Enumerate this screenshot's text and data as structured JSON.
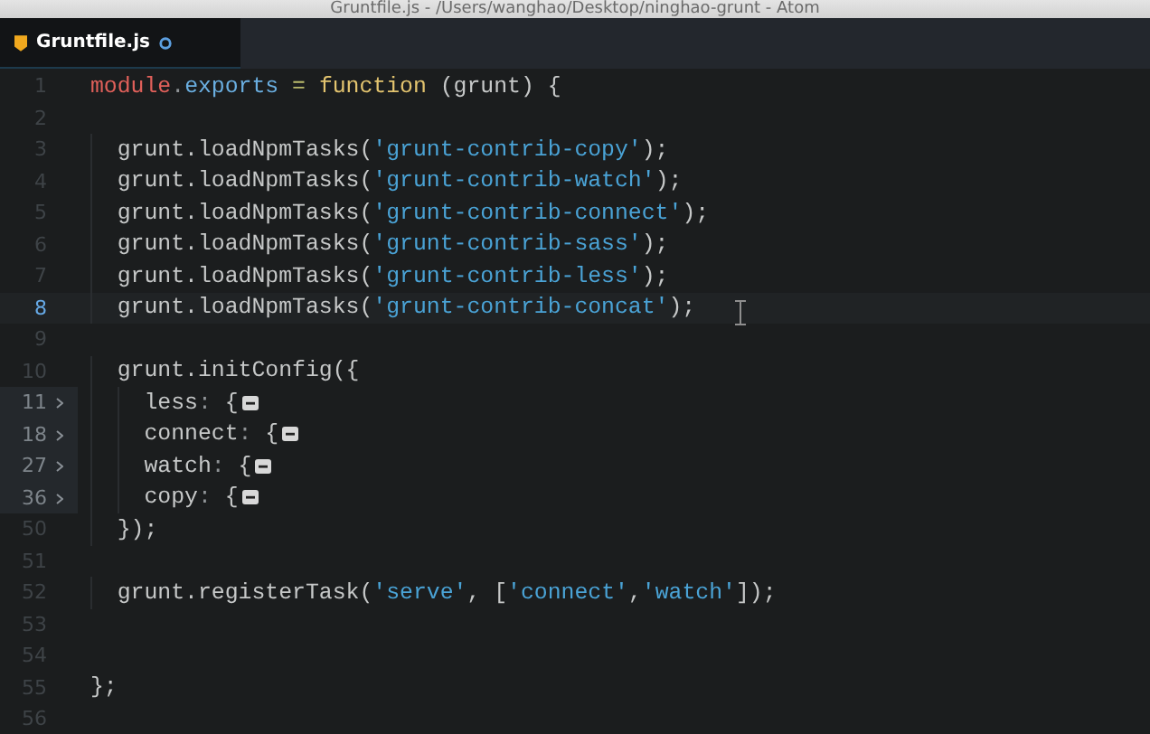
{
  "window": {
    "title": "Gruntfile.js - /Users/wanghao/Desktop/ninghao-grunt - Atom"
  },
  "tabs": [
    {
      "label": "Gruntfile.js",
      "selected": true,
      "modified": true
    }
  ],
  "lines": [
    {
      "number": "1",
      "current": false,
      "folded": false,
      "tokens": [
        {
          "kind": "variable",
          "text": "module"
        },
        {
          "kind": "punct",
          "text": "."
        },
        {
          "kind": "property",
          "text": "exports"
        },
        {
          "kind": "operator",
          "text": " = "
        },
        {
          "kind": "keyword",
          "text": "function"
        },
        {
          "kind": "plain",
          "text": " (grunt) {"
        }
      ]
    },
    {
      "number": "2",
      "current": false,
      "folded": false
    },
    {
      "number": "3",
      "current": false,
      "folded": false,
      "tokens": [
        {
          "kind": "plain",
          "text": "  grunt.loadNpmTasks("
        },
        {
          "kind": "string",
          "text": "'grunt-contrib-copy'"
        },
        {
          "kind": "plain",
          "text": ");"
        }
      ]
    },
    {
      "number": "4",
      "current": false,
      "folded": false,
      "tokens": [
        {
          "kind": "plain",
          "text": "  grunt.loadNpmTasks("
        },
        {
          "kind": "string",
          "text": "'grunt-contrib-watch'"
        },
        {
          "kind": "plain",
          "text": ");"
        }
      ]
    },
    {
      "number": "5",
      "current": false,
      "folded": false,
      "tokens": [
        {
          "kind": "plain",
          "text": "  grunt.loadNpmTasks("
        },
        {
          "kind": "string",
          "text": "'grunt-contrib-connect'"
        },
        {
          "kind": "plain",
          "text": ");"
        }
      ]
    },
    {
      "number": "6",
      "current": false,
      "folded": false,
      "tokens": [
        {
          "kind": "plain",
          "text": "  grunt.loadNpmTasks("
        },
        {
          "kind": "string",
          "text": "'grunt-contrib-sass'"
        },
        {
          "kind": "plain",
          "text": ");"
        }
      ]
    },
    {
      "number": "7",
      "current": false,
      "folded": false,
      "tokens": [
        {
          "kind": "plain",
          "text": "  grunt.loadNpmTasks("
        },
        {
          "kind": "string",
          "text": "'grunt-contrib-less'"
        },
        {
          "kind": "plain",
          "text": ");"
        }
      ]
    },
    {
      "number": "8",
      "current": true,
      "folded": false,
      "tokens": [
        {
          "kind": "plain",
          "text": "  grunt.loadNpmTasks("
        },
        {
          "kind": "string",
          "text": "'grunt-contrib-concat'"
        },
        {
          "kind": "plain",
          "text": ");"
        }
      ]
    },
    {
      "number": "9",
      "current": false,
      "folded": false
    },
    {
      "number": "10",
      "current": false,
      "folded": false,
      "tokens": [
        {
          "kind": "plain",
          "text": "  grunt.initConfig({"
        }
      ]
    },
    {
      "number": "11",
      "current": false,
      "folded": true,
      "tokens": [
        {
          "kind": "plain",
          "text": "    less"
        },
        {
          "kind": "punct",
          "text": ":"
        },
        {
          "kind": "plain",
          "text": " {"
        }
      ]
    },
    {
      "number": "18",
      "current": false,
      "folded": true,
      "tokens": [
        {
          "kind": "plain",
          "text": "    connect"
        },
        {
          "kind": "punct",
          "text": ":"
        },
        {
          "kind": "plain",
          "text": " {"
        }
      ]
    },
    {
      "number": "27",
      "current": false,
      "folded": true,
      "tokens": [
        {
          "kind": "plain",
          "text": "    watch"
        },
        {
          "kind": "punct",
          "text": ":"
        },
        {
          "kind": "plain",
          "text": " {"
        }
      ]
    },
    {
      "number": "36",
      "current": false,
      "folded": true,
      "tokens": [
        {
          "kind": "plain",
          "text": "    copy"
        },
        {
          "kind": "punct",
          "text": ":"
        },
        {
          "kind": "plain",
          "text": " {"
        }
      ]
    },
    {
      "number": "50",
      "current": false,
      "folded": false,
      "tokens": [
        {
          "kind": "plain",
          "text": "  });"
        }
      ]
    },
    {
      "number": "51",
      "current": false,
      "folded": false
    },
    {
      "number": "52",
      "current": false,
      "folded": false,
      "tokens": [
        {
          "kind": "plain",
          "text": "  grunt.registerTask("
        },
        {
          "kind": "string",
          "text": "'serve'"
        },
        {
          "kind": "plain",
          "text": ", ["
        },
        {
          "kind": "string",
          "text": "'connect'"
        },
        {
          "kind": "plain",
          "text": ","
        },
        {
          "kind": "string",
          "text": "'watch'"
        },
        {
          "kind": "plain",
          "text": "]);"
        }
      ]
    },
    {
      "number": "53",
      "current": false,
      "folded": false
    },
    {
      "number": "54",
      "current": false,
      "folded": false
    },
    {
      "number": "55",
      "current": false,
      "folded": false,
      "tokens": [
        {
          "kind": "plain",
          "text": "};"
        }
      ]
    },
    {
      "number": "56",
      "current": false,
      "folded": false
    }
  ]
}
